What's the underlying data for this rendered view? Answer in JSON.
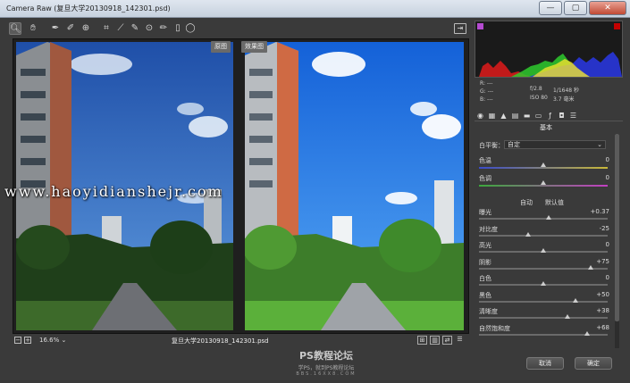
{
  "window": {
    "title": "Camera Raw (复旦大学20130918_142301.psd)",
    "min": "—",
    "max": "▢",
    "close": "✕"
  },
  "toolbar": {
    "tools": [
      "zoom-icon",
      "hand-icon",
      "white-balance-icon",
      "color-sampler-icon",
      "target-adjust-icon",
      "crop-icon",
      "straighten-icon",
      "spot-removal-icon",
      "red-eye-icon",
      "adjustment-brush-icon",
      "graduated-filter-icon",
      "radial-filter-icon"
    ],
    "open_prefs": "preferences-icon"
  },
  "preview": {
    "before_label": "原图",
    "after_label": "效果图",
    "watermark": "www.haoyidianshejr.com"
  },
  "status": {
    "zoom": "16.6%",
    "filename": "复旦大学20130918_142301.psd",
    "minus": "−",
    "plus": "+"
  },
  "footer_watermark": {
    "title": "PS教程论坛",
    "subtitle": "学PS，就到PS教程论坛",
    "url": "BBS.16XX8.COM"
  },
  "buttons": {
    "cancel": "取消",
    "ok": "确定"
  },
  "camera_info": {
    "r": "R: ---",
    "g": "G: ---",
    "b": "B: ---",
    "aperture": "f/2.8",
    "shutter": "1/1648 秒",
    "iso": "ISO 80",
    "focal": "3.7 毫米"
  },
  "panel": {
    "title": "基本"
  },
  "settings": {
    "white_balance_label": "白平衡：",
    "white_balance_value": "自定",
    "temperature": {
      "label": "色温",
      "value": "0",
      "level": 0.5
    },
    "tint": {
      "label": "色调",
      "value": "0",
      "level": 0.5
    },
    "auto": "自动",
    "default": "默认值",
    "sliders": [
      {
        "label": "曝光",
        "value": "+0.37",
        "level": 0.54
      },
      {
        "label": "对比度",
        "value": "-25",
        "level": 0.38
      },
      {
        "label": "高光",
        "value": "0",
        "level": 0.5
      },
      {
        "label": "阴影",
        "value": "+75",
        "level": 0.87
      },
      {
        "label": "白色",
        "value": "0",
        "level": 0.5
      },
      {
        "label": "黑色",
        "value": "+50",
        "level": 0.75
      },
      {
        "label": "清晰度",
        "value": "+38",
        "level": 0.69
      },
      {
        "label": "自然饱和度",
        "value": "+68",
        "level": 0.84
      }
    ]
  },
  "colors": {
    "accent": "#c6d1de",
    "close": "#c04a35",
    "panel_bg": "#3a3a3a"
  }
}
